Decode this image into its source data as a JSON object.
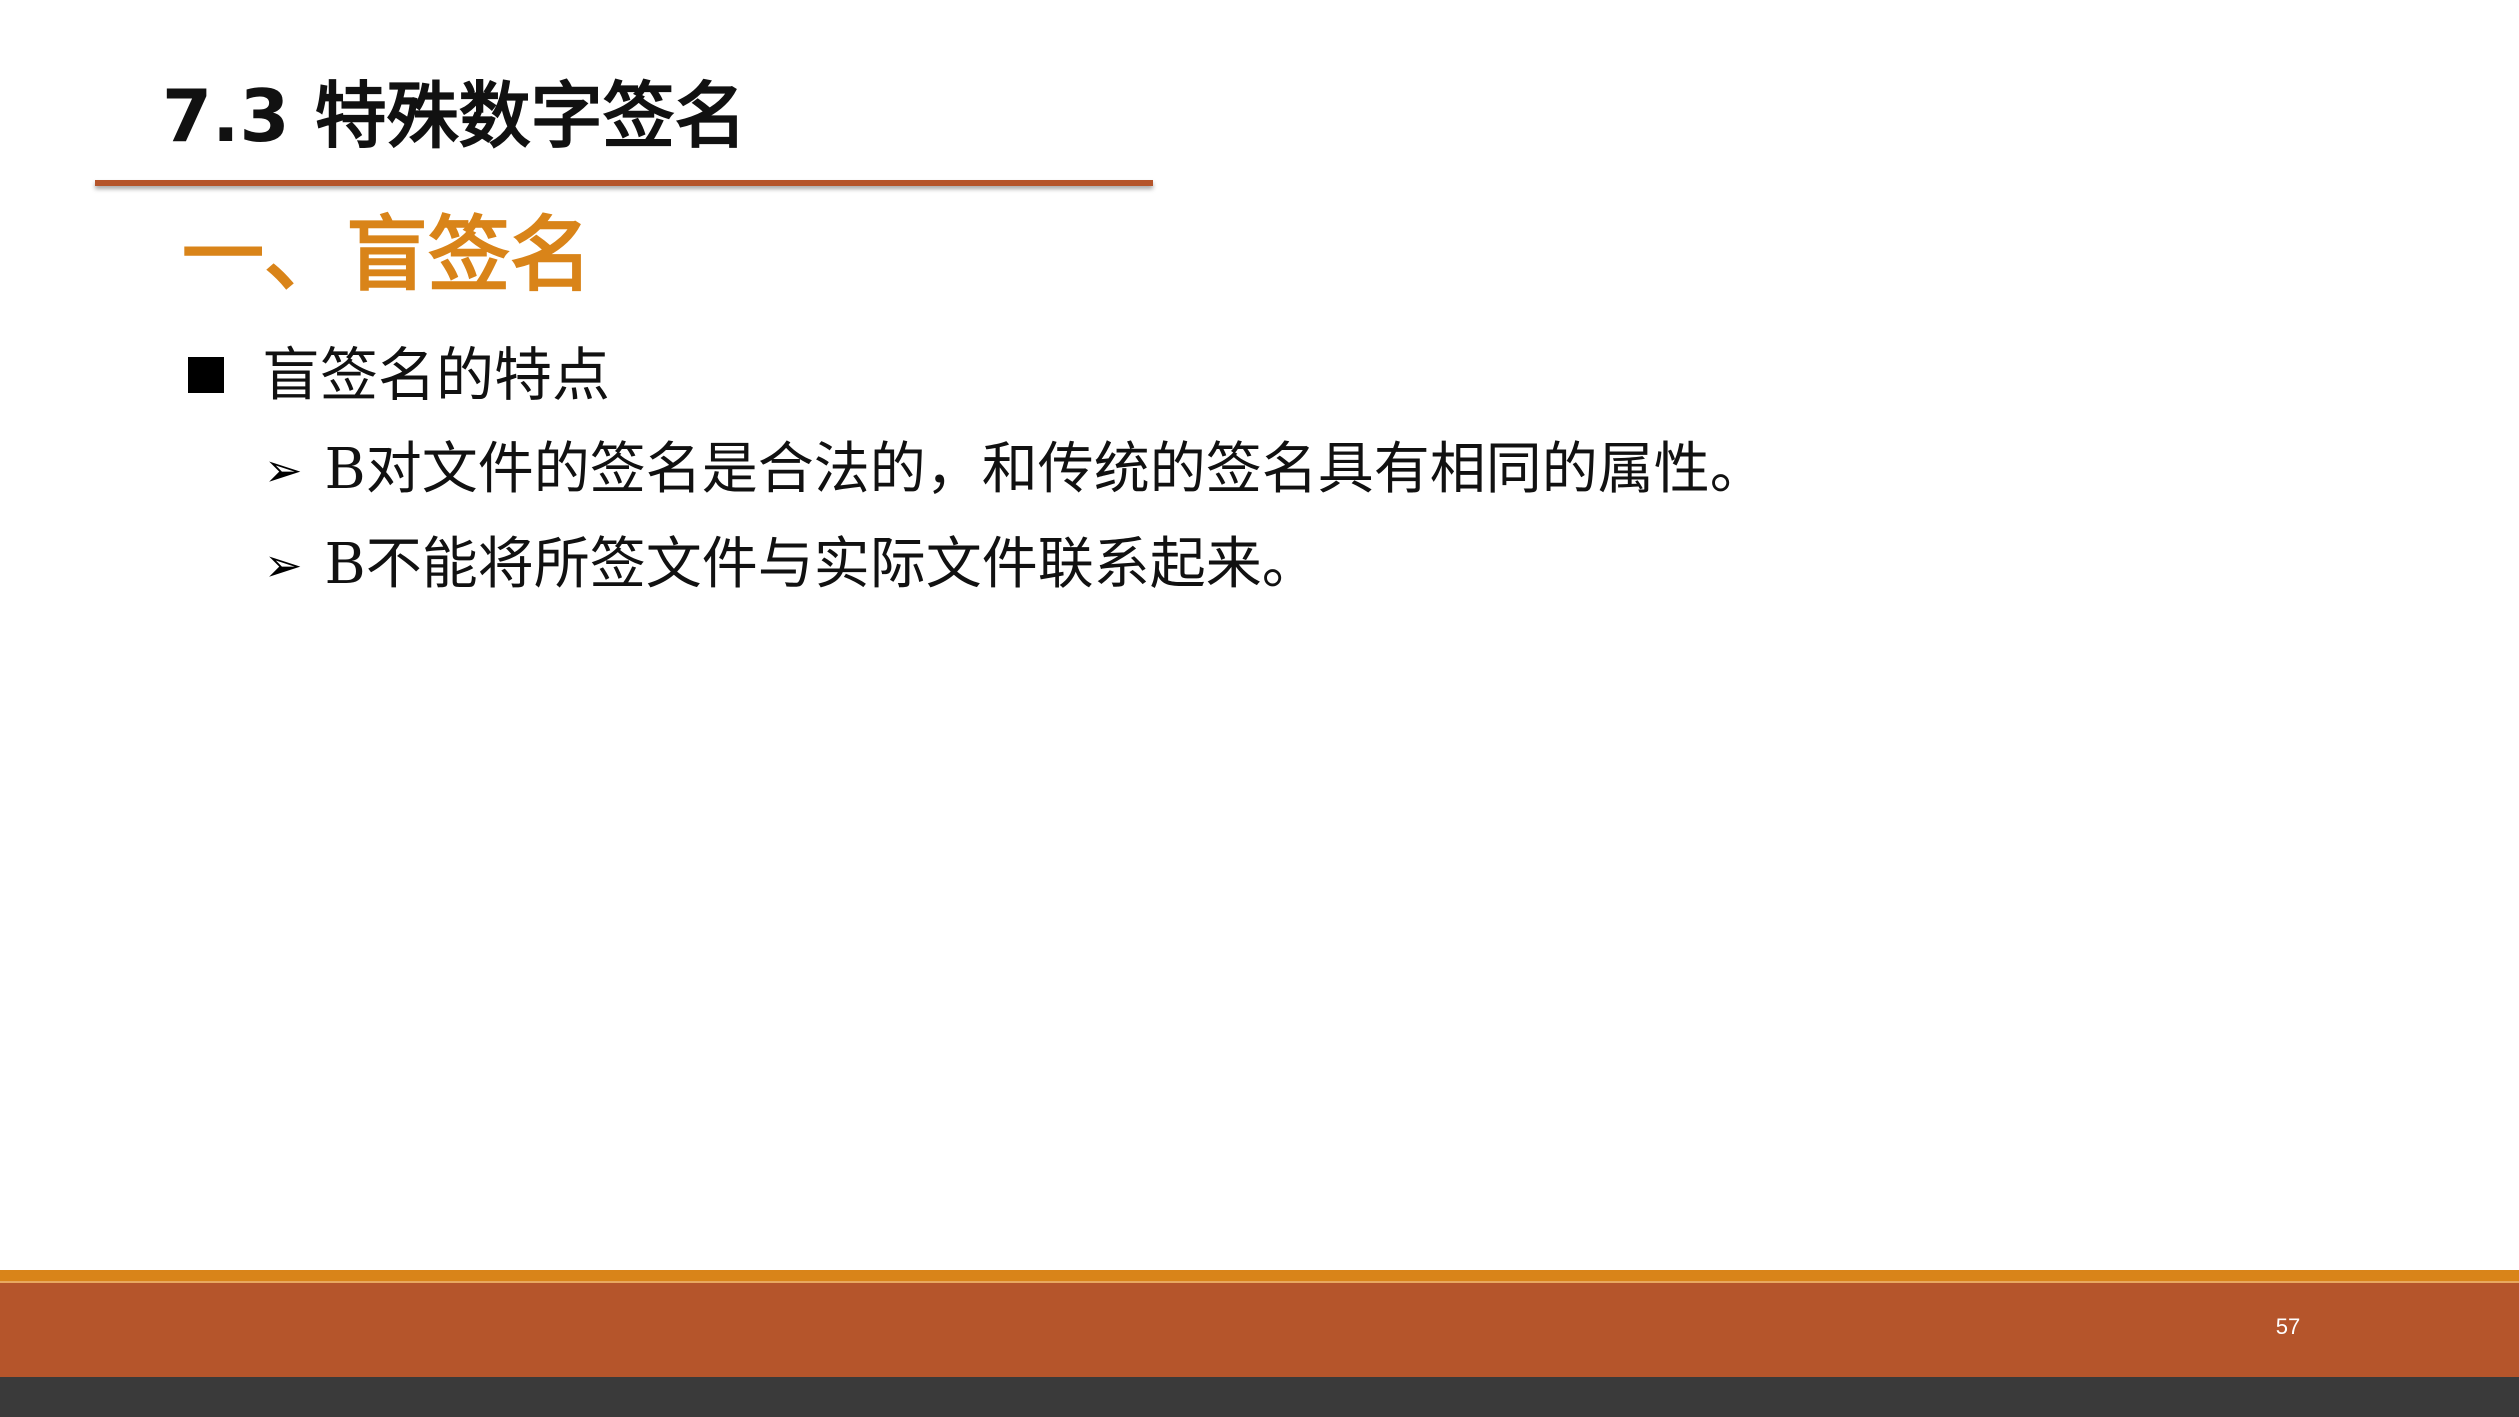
{
  "slide": {
    "title": "7.3 特殊数字签名",
    "section_heading": "一、盲签名",
    "bullet": {
      "text": "盲签名的特点",
      "sub_items": [
        {
          "marker": "➢",
          "text": "B对文件的签名是合法的，和传统的签名具有相同的属性。"
        },
        {
          "marker": "➢",
          "text": "B不能将所签文件与实际文件联系起来。"
        }
      ]
    },
    "page_number": "57"
  },
  "colors": {
    "accent_orange": "#d98419",
    "band_rust": "#b5552b",
    "footer_dark": "#3a3a3a"
  }
}
